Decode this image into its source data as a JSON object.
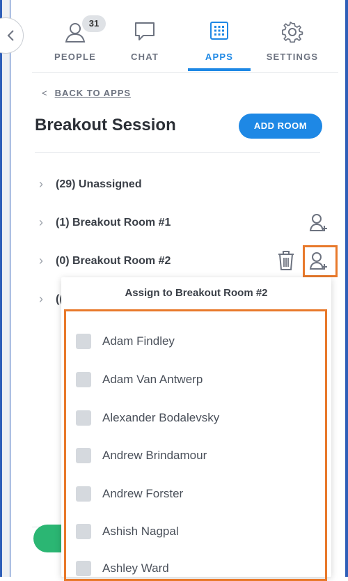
{
  "nav": {
    "tabs": [
      {
        "label": "PEOPLE",
        "badge": "31"
      },
      {
        "label": "CHAT"
      },
      {
        "label": "APPS"
      },
      {
        "label": "SETTINGS"
      }
    ],
    "active_tab": "APPS",
    "accent": "#1e88e5"
  },
  "header": {
    "back_link": "BACK TO APPS",
    "title": "Breakout Session",
    "add_room_label": "ADD ROOM"
  },
  "rooms": [
    {
      "label": "(29) Unassigned"
    },
    {
      "label": "(1) Breakout Room #1"
    },
    {
      "label": "(0) Breakout Room #2"
    },
    {
      "label": "(("
    }
  ],
  "assign_popup": {
    "title": "Assign to Breakout Room #2",
    "members": [
      "Adam Findley",
      "Adam Van Antwerp",
      "Alexander Bodalevsky",
      "Andrew Brindamour",
      "Andrew Forster",
      "Ashish Nagpal",
      "Ashley Ward"
    ]
  },
  "colors": {
    "highlight": "#e8792b",
    "primary_button": "#1e88e5",
    "green_button": "#2bb673"
  }
}
